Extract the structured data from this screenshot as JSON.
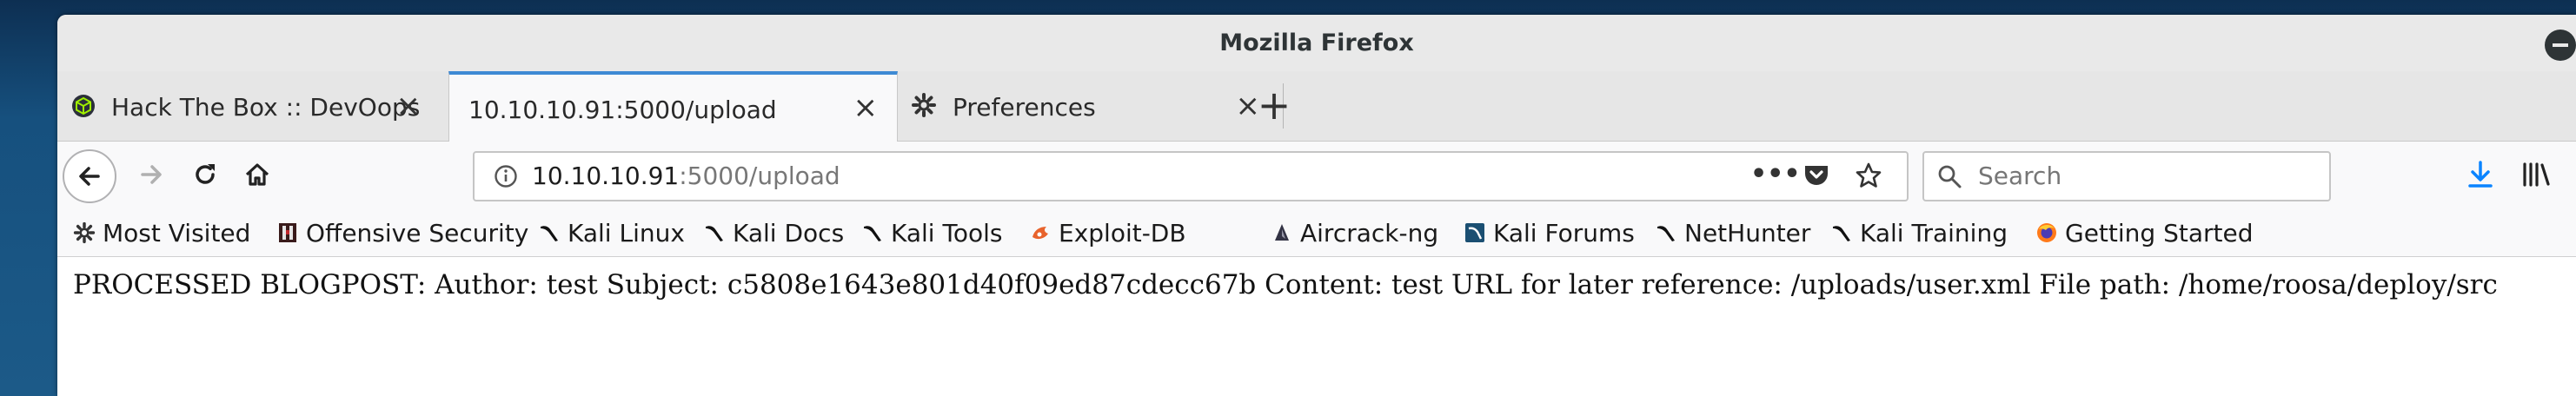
{
  "window": {
    "title": "Mozilla Firefox"
  },
  "tabs": [
    {
      "label": "Hack The Box :: DevOops",
      "icon": "htb-cube-icon",
      "active": false
    },
    {
      "label": "10.10.10.91:5000/upload",
      "icon": "",
      "active": true
    },
    {
      "label": "Preferences",
      "icon": "gear-icon",
      "active": false
    }
  ],
  "url": {
    "host": "10.10.10.91",
    "rest": ":5000/upload"
  },
  "search": {
    "placeholder": "Search"
  },
  "bookmarks": [
    {
      "label": "Most Visited",
      "icon": "gear-icon"
    },
    {
      "label": "Offensive Security",
      "icon": "offsec-icon"
    },
    {
      "label": "Kali Linux",
      "icon": "kali-dragon-icon"
    },
    {
      "label": "Kali Docs",
      "icon": "kali-dragon-icon"
    },
    {
      "label": "Kali Tools",
      "icon": "kali-dragon-icon"
    },
    {
      "label": "Exploit-DB",
      "icon": "exploitdb-icon"
    },
    {
      "label": "Aircrack-ng",
      "icon": "aircrack-icon"
    },
    {
      "label": "Kali Forums",
      "icon": "kali-forums-icon"
    },
    {
      "label": "NetHunter",
      "icon": "kali-dragon-icon"
    },
    {
      "label": "Kali Training",
      "icon": "kali-dragon-icon"
    },
    {
      "label": "Getting Started",
      "icon": "firefox-icon"
    }
  ],
  "page": {
    "text": "PROCESSED BLOGPOST: Author: test Subject: c5808e1643e801d40f09ed87cdecc67b Content: test URL for later reference: /uploads/user.xml File path: /home/roosa/deploy/src"
  },
  "colors": {
    "accent": "#3e8ad4",
    "download_arrow": "#0a84ff"
  }
}
